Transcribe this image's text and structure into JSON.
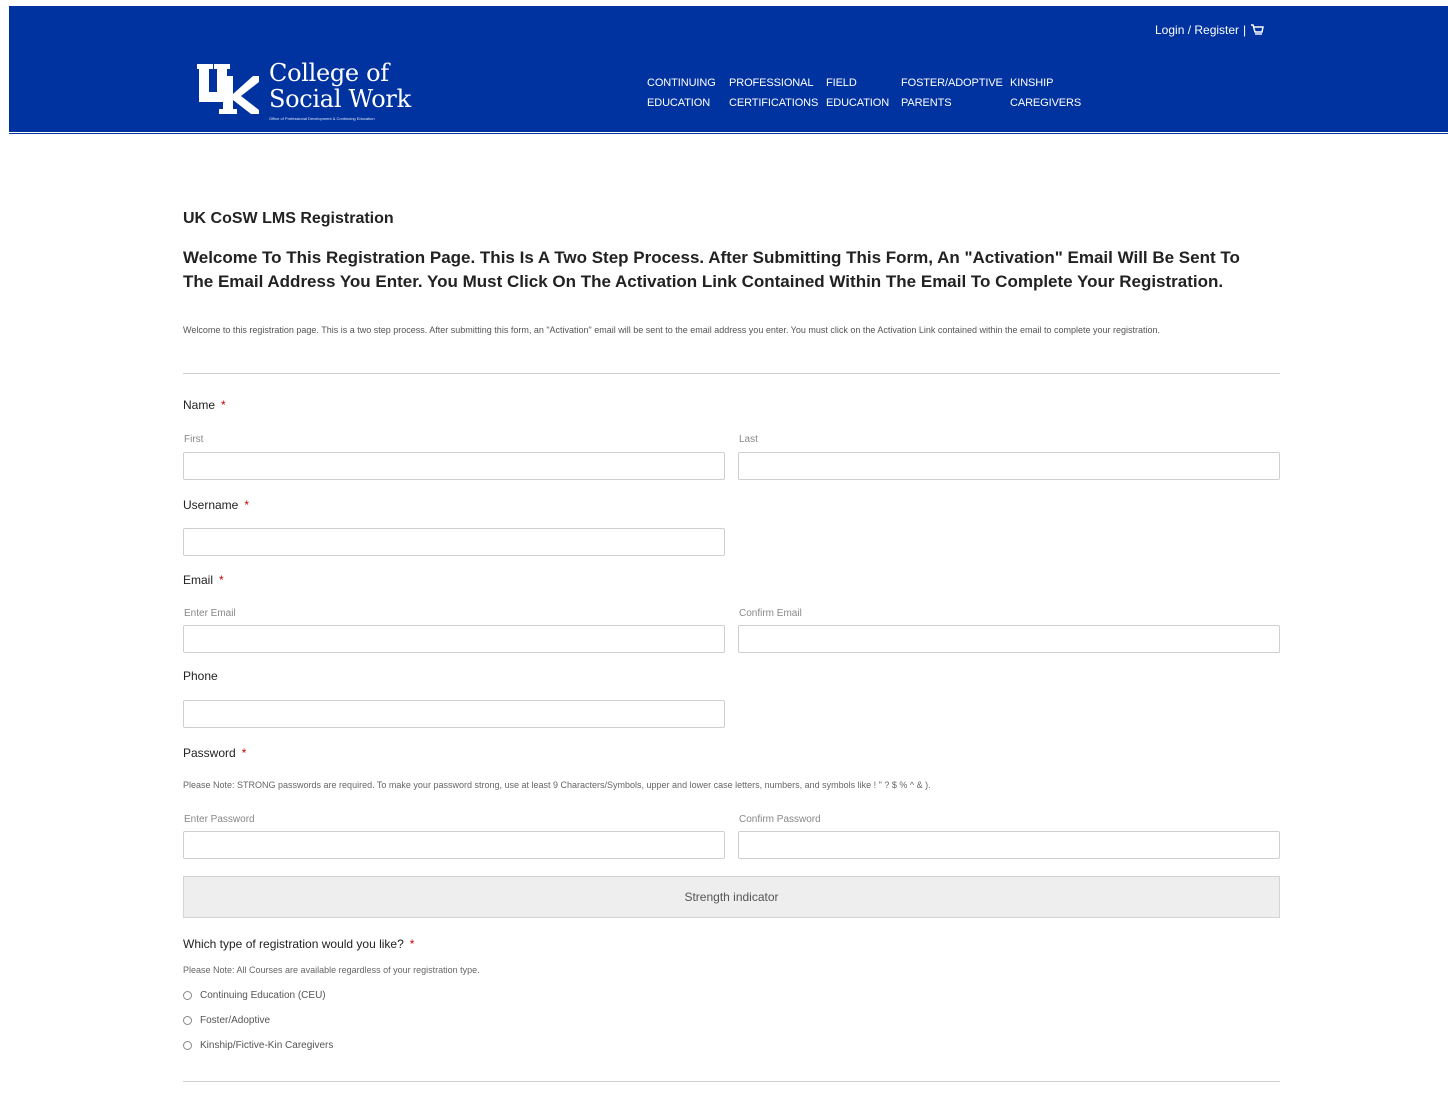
{
  "header": {
    "logo_title": "College of Social Work",
    "logo_title_line1": "College of",
    "logo_title_line2": "Social Work",
    "logo_subtitle": "Office of Professional Development & Continuing Education",
    "login_label": "Login / Register",
    "separator": "|",
    "cart_icon": "cart-icon",
    "nav": [
      {
        "line1": "CONTINUING",
        "line2": "EDUCATION"
      },
      {
        "line1": "PROFESSIONAL",
        "line2": "CERTIFICATIONS"
      },
      {
        "line1": "FIELD",
        "line2": "EDUCATION"
      },
      {
        "line1": "FOSTER/ADOPTIVE",
        "line2": "PARENTS"
      },
      {
        "line1": "KINSHIP",
        "line2": "CAREGIVERS"
      }
    ],
    "brand_color": "#0033a0"
  },
  "form": {
    "page_title": "UK CoSW LMS Registration",
    "welcome_heading": "Welcome To This Registration Page. This Is A Two Step Process. After Submitting This Form, An \"Activation\" Email Will Be Sent To The Email Address You Enter. You Must Click On The Activation Link Contained Within The Email To Complete Your Registration.",
    "welcome_text": "Welcome to this registration page. This is a two step process. After submitting this form, an \"Activation\" email will be sent to the email address you enter. You must click on the Activation Link contained within the email to complete your registration.",
    "name": {
      "label": "Name",
      "first": "First",
      "last": "Last",
      "first_value": "",
      "last_value": ""
    },
    "username": {
      "label": "Username",
      "value": ""
    },
    "email": {
      "label": "Email",
      "enter": "Enter Email",
      "confirm": "Confirm Email",
      "enter_value": "",
      "confirm_value": ""
    },
    "phone": {
      "label": "Phone",
      "value": ""
    },
    "password": {
      "label": "Password",
      "note": "Please Note: STRONG passwords are required. To make your password strong, use at least 9 Characters/Symbols, upper and lower case letters, numbers, and symbols like ! \" ? $ % ^ & ).",
      "enter": "Enter Password",
      "confirm": "Confirm Password",
      "strength": "Strength indicator"
    },
    "registration_type": {
      "label": "Which type of registration would you like?",
      "note": "Please Note: All Courses are available regardless of your registration type.",
      "options": [
        "Continuing Education (CEU)",
        "Foster/Adoptive",
        "Kinship/Fictive-Kin Caregivers"
      ],
      "selected": ""
    },
    "required_mark": "*"
  }
}
